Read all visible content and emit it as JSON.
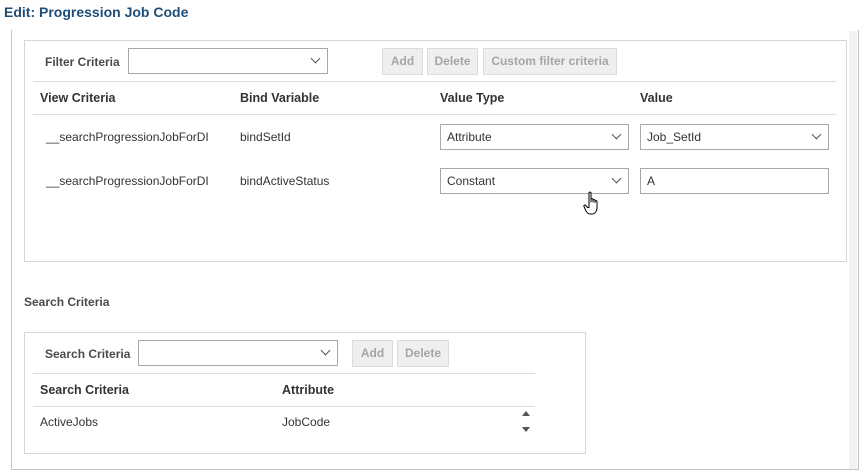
{
  "dialog": {
    "title": "Edit: Progression Job Code"
  },
  "filter": {
    "label": "Filter Criteria",
    "select_value": "",
    "buttons": {
      "add": "Add",
      "delete": "Delete",
      "custom": "Custom filter criteria"
    },
    "columns": [
      "View Criteria",
      "Bind Variable",
      "Value Type",
      "Value"
    ],
    "rows": [
      {
        "view_criteria": "__searchProgressionJobForDI",
        "bind_variable": "bindSetId",
        "value_type": "Attribute",
        "value": "Job_SetId"
      },
      {
        "view_criteria": "__searchProgressionJobForDI",
        "bind_variable": "bindActiveStatus",
        "value_type": "Constant",
        "value": "A"
      }
    ]
  },
  "search": {
    "section_title": "Search Criteria",
    "label": "Search Criteria",
    "select_value": "",
    "buttons": {
      "add": "Add",
      "delete": "Delete"
    },
    "columns": [
      "Search Criteria",
      "Attribute"
    ],
    "rows": [
      {
        "criteria": "ActiveJobs",
        "attribute": "JobCode"
      }
    ]
  },
  "icons": {
    "chevron": "chevron-down-icon",
    "cursor": "hand-pointer-icon",
    "scroll_up": "scroll-up-arrow-icon",
    "scroll_down": "scroll-down-arrow-icon"
  }
}
